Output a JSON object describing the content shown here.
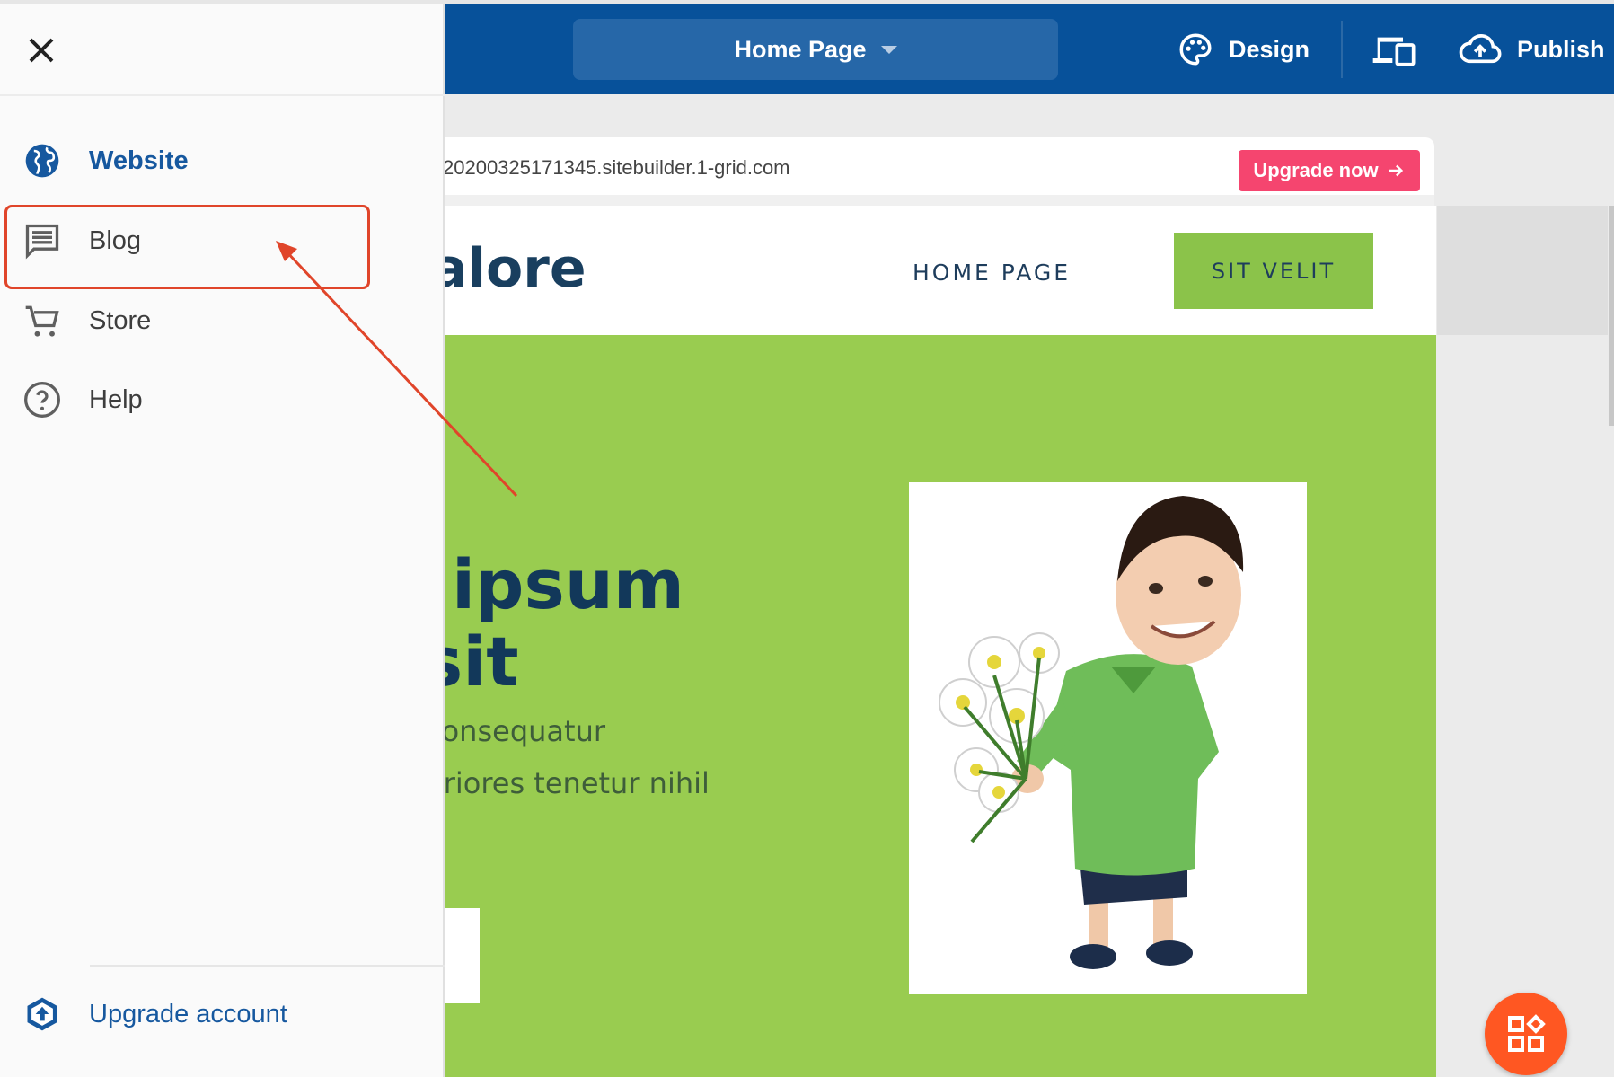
{
  "topbar": {
    "page_selector": "Home Page",
    "design_label": "Design",
    "publish_label": "Publish"
  },
  "urlbar": {
    "url": "20200325171345.sitebuilder.1-grid.com",
    "upgrade_now": "Upgrade now"
  },
  "site": {
    "logo": "alore",
    "nav": {
      "home": "HOME PAGE",
      "button": "SIT VELIT"
    },
    "hero": {
      "title_line1": "ipsum",
      "title_line2": "sit",
      "text_line1": "consequatur",
      "text_line2": "eriores tenetur nihil"
    }
  },
  "sidebar": {
    "items": [
      {
        "label": "Website",
        "icon": "globe-icon",
        "active": true
      },
      {
        "label": "Blog",
        "icon": "blog-icon",
        "active": false
      },
      {
        "label": "Store",
        "icon": "cart-icon",
        "active": false
      },
      {
        "label": "Help",
        "icon": "help-circle-icon",
        "active": false
      }
    ],
    "upgrade_account": "Upgrade account"
  },
  "colors": {
    "topbar": "#07519a",
    "page_selector": "#2667a8",
    "upgrade_now": "#f5456f",
    "hero_green": "#99cc50",
    "nav_button_green": "#8bc34a",
    "fab": "#ff5722",
    "annotation_red": "#e0452a",
    "active_blue": "#16589f"
  }
}
